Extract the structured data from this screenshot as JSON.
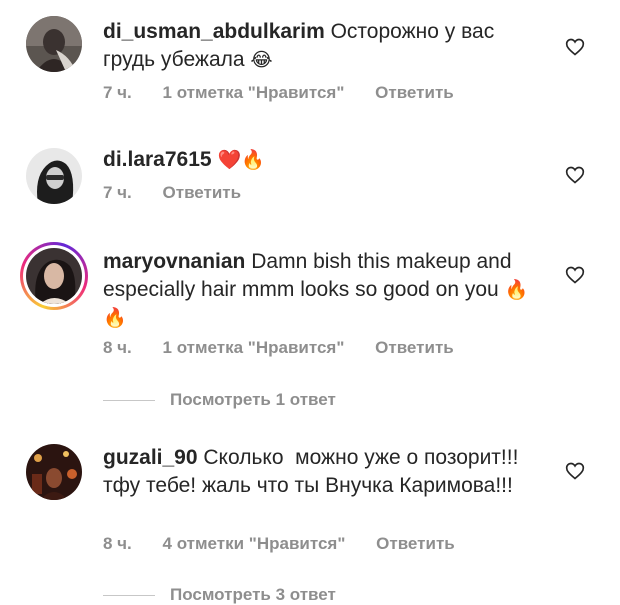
{
  "comments": [
    {
      "username": "di_usman_abdulkarim",
      "text": "Осторожно у вас грудь убежала",
      "emoji": "😂",
      "time": "7 ч.",
      "likes": "1 отметка \"Нравится\"",
      "reply": "Ответить"
    },
    {
      "username": "di.lara7615",
      "text": "",
      "emoji": "❤️🔥",
      "time": "7 ч.",
      "likes": "",
      "reply": "Ответить"
    },
    {
      "username": "maryovnanian",
      "text": "Damn bish this makeup and especially hair mmm looks so good on you",
      "emoji": "🔥🔥",
      "time": "8 ч.",
      "likes": "1 отметка \"Нравится\"",
      "reply": "Ответить",
      "view_replies": "Посмотреть 1 ответ"
    },
    {
      "username": "guzali_90",
      "text": "Сколько  можно уже о позорит!!! тфу тебе! жаль что ты Внучка Каримова!!!",
      "emoji": "",
      "time": "8 ч.",
      "likes": "4 отметки \"Нравится\"",
      "reply": "Ответить",
      "view_replies": "Посмотреть 3 ответ"
    }
  ],
  "icons": {
    "like": "heart-outline-icon"
  },
  "colors": {
    "text": "#262626",
    "meta": "#8e8e8e",
    "story_ring": "#ee2a7b"
  }
}
